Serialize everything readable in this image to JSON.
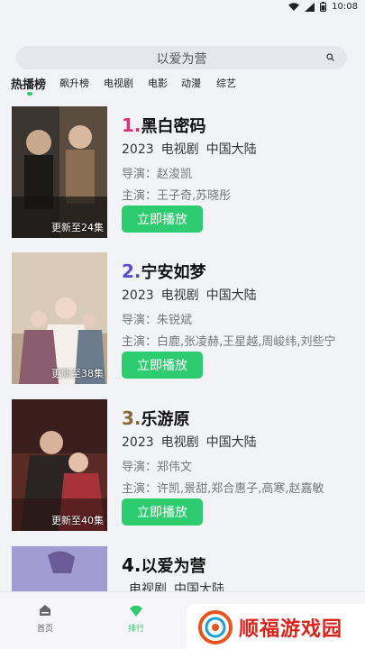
{
  "status_bar": {
    "time": "10:08"
  },
  "search": {
    "text": "以爱为营"
  },
  "tabs": [
    {
      "label": "热播榜",
      "active": true
    },
    {
      "label": "飙升榜"
    },
    {
      "label": "电视剧"
    },
    {
      "label": "电影"
    },
    {
      "label": "动漫"
    },
    {
      "label": "综艺"
    }
  ],
  "items": [
    {
      "rank": "1.",
      "title": "黑白密码",
      "year": "2023",
      "type": "电视剧",
      "region": "中国大陆",
      "director_label": "导演：",
      "director": "赵浚凯",
      "cast_label": "主演：",
      "cast": "王子奇,苏晓彤",
      "badge": "更新至24集",
      "play_label": "立即播放",
      "rank_color": "#e0307a",
      "poster_color": "#2a2724",
      "poster_text": "黑白密码"
    },
    {
      "rank": "2.",
      "title": "宁安如梦",
      "year": "2023",
      "type": "电视剧",
      "region": "中国大陆",
      "director_label": "导演：",
      "director": "朱锐斌",
      "cast_label": "主演：",
      "cast": "白鹿,张凌赫,王星越,周峻纬,刘些宁",
      "badge": "更新至38集",
      "play_label": "立即播放",
      "rank_color": "#5b4fd0",
      "poster_color": "#d9cbb8",
      "poster_text": "宁安如梦"
    },
    {
      "rank": "3.",
      "title": "乐游原",
      "year": "2023",
      "type": "电视剧",
      "region": "中国大陆",
      "director_label": "导演：",
      "director": "郑伟文",
      "cast_label": "主演：",
      "cast": "许凯,景甜,郑合惠子,高寒,赵嘉敏",
      "badge": "更新至40集",
      "play_label": "立即播放",
      "rank_color": "#8a6a3a",
      "poster_color": "#5a2a24",
      "poster_text": "乐游原"
    },
    {
      "rank": "4.",
      "title": "以爱为营",
      "year": "",
      "type": "电视剧",
      "region": "中国大陆",
      "director_label": "",
      "director": "",
      "cast_label": "",
      "cast": "",
      "badge": "",
      "play_label": "",
      "rank_color": "#111111",
      "poster_color": "#8a86c4",
      "poster_text": "以爱为营"
    }
  ],
  "bottom_nav": [
    {
      "label": "首页",
      "icon": "home-icon"
    },
    {
      "label": "排行",
      "icon": "rank-icon",
      "active": true
    }
  ],
  "watermark": {
    "text": "顺福游戏园"
  }
}
